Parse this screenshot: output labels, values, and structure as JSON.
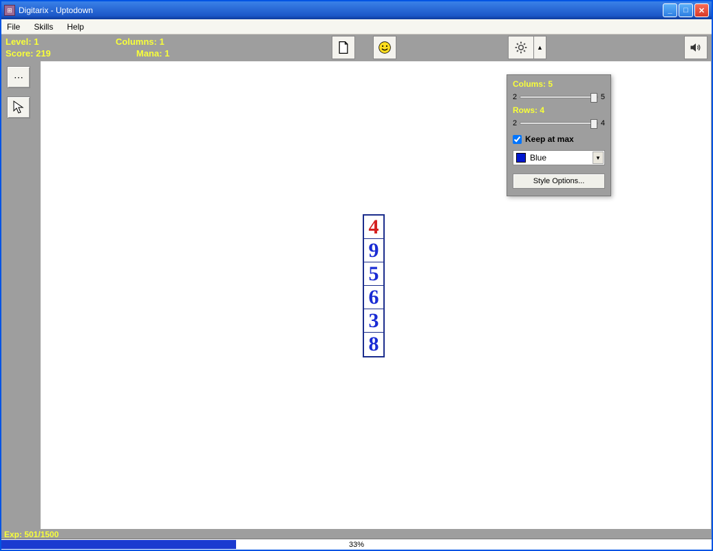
{
  "window": {
    "title": "Digitarix - Uptodown"
  },
  "menu": {
    "file": "File",
    "skills": "Skills",
    "help": "Help"
  },
  "stats": {
    "level_label": "Level:",
    "level_val": "1",
    "columns_label": "Columns:",
    "columns_val": "1",
    "score_label": "Score:",
    "score_val": "219",
    "mana_label": "Mana:",
    "mana_val": "1"
  },
  "cells": [
    "4",
    "9",
    "5",
    "6",
    "3",
    "8"
  ],
  "settings": {
    "cols_label": "Colums: 5",
    "cols_min": "2",
    "cols_max": "5",
    "rows_label": "Rows: 4",
    "rows_min": "2",
    "rows_max": "4",
    "keep_max": "Keep at max",
    "color_name": "Blue",
    "style_btn": "Style Options..."
  },
  "exp": "Exp: 501/1500",
  "progress_pct": "33%",
  "icons": {
    "gear_drop": "▲",
    "dd_arrow": "▼"
  }
}
